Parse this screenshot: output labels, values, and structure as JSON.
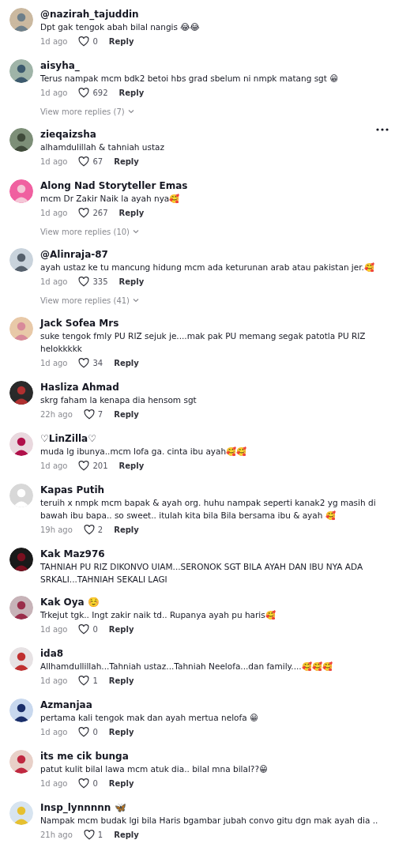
{
  "comments": [
    {
      "username": "@nazirah_tajuddin",
      "text": "Dpt gak tengok abah bilal nangis 😂😂",
      "time": "1d ago",
      "likes": "0",
      "reply": "Reply",
      "menu_shown": false
    },
    {
      "username": "aisyha_",
      "text": "Terus nampak mcm bdk2 betoi hbs grad sbelum ni nmpk matang sgt 😁",
      "time": "1d ago",
      "likes": "692",
      "reply": "Reply",
      "more_replies": "View more replies (7)",
      "menu_shown": false
    },
    {
      "username": "zieqaizsha",
      "text": "alhamdulillah & tahniah ustaz",
      "time": "1d ago",
      "likes": "67",
      "reply": "Reply",
      "menu_shown": true
    },
    {
      "username": "Along Nad Storyteller Emas",
      "text": "mcm Dr Zakir Naik la ayah nya🥰",
      "time": "1d ago",
      "likes": "267",
      "reply": "Reply",
      "more_replies": "View more replies (10)",
      "menu_shown": false
    },
    {
      "username": "@Alinraja-87",
      "text": "ayah ustaz ke tu mancung hidung mcm ada keturunan arab atau pakistan jer.🥰",
      "time": "1d ago",
      "likes": "335",
      "reply": "Reply",
      "more_replies": "View more replies (41)",
      "menu_shown": false
    },
    {
      "username": "Jack Sofea Mrs",
      "text": "suke tengok fmly PU RIZ sejuk je....mak pak PU memang segak patotla PU RIZ helokkkkk",
      "time": "1d ago",
      "likes": "34",
      "reply": "Reply",
      "menu_shown": false
    },
    {
      "username": "Hasliza Ahmad",
      "text": "skrg faham la kenapa dia hensom sgt",
      "time": "22h ago",
      "likes": "7",
      "reply": "Reply",
      "menu_shown": false
    },
    {
      "username": "♡LinZilla♡",
      "text": "muda lg ibunya..mcm lofa ga. cinta ibu ayah🥰🥰",
      "time": "1d ago",
      "likes": "201",
      "reply": "Reply",
      "menu_shown": false
    },
    {
      "username": "Kapas Putih",
      "text": "teruih x nmpk mcm bapak & ayah org. huhu nampak seperti kanak2 yg masih di bawah ibu bapa.. so sweet.. itulah kita bila Bila bersama ibu & ayah 🥰",
      "time": "19h ago",
      "likes": "2",
      "reply": "Reply",
      "menu_shown": false
    },
    {
      "username": "Kak Maz976",
      "text": "TAHNIAH PU RIZ DIKONVO UIAM...SERONOK SGT BILA AYAH DAN IBU NYA ADA SRKALI...TAHNIAH SEKALI LAGI",
      "menu_shown": false
    },
    {
      "username": "Kak Oya ☺️",
      "text": "Trkejut tgk.. Ingt zakir naik td.. Rupanya ayah pu haris🥰",
      "time": "1d ago",
      "likes": "0",
      "reply": "Reply",
      "menu_shown": false
    },
    {
      "username": "ida8",
      "text": "Allhamdullillah...Tahniah ustaz...Tahniah Neelofa...dan family....🥰🥰🥰",
      "time": "1d ago",
      "likes": "1",
      "reply": "Reply",
      "menu_shown": false
    },
    {
      "username": "Azmanjaa",
      "text": "pertama kali tengok mak dan ayah mertua nelofa 😁",
      "time": "1d ago",
      "likes": "0",
      "reply": "Reply",
      "menu_shown": false
    },
    {
      "username": "its me cik bunga",
      "text": "patut kulit bilal lawa mcm atuk dia.. bilal mna bilal??😁",
      "time": "1d ago",
      "likes": "0",
      "reply": "Reply",
      "menu_shown": false
    },
    {
      "username": "Insp_lynnnnn 🦋",
      "text": "Nampak mcm budak lgi bila Haris bgambar jubah convo gitu dgn mak ayah dia ..",
      "time": "21h ago",
      "likes": "1",
      "reply": "Reply",
      "menu_shown": false
    }
  ]
}
